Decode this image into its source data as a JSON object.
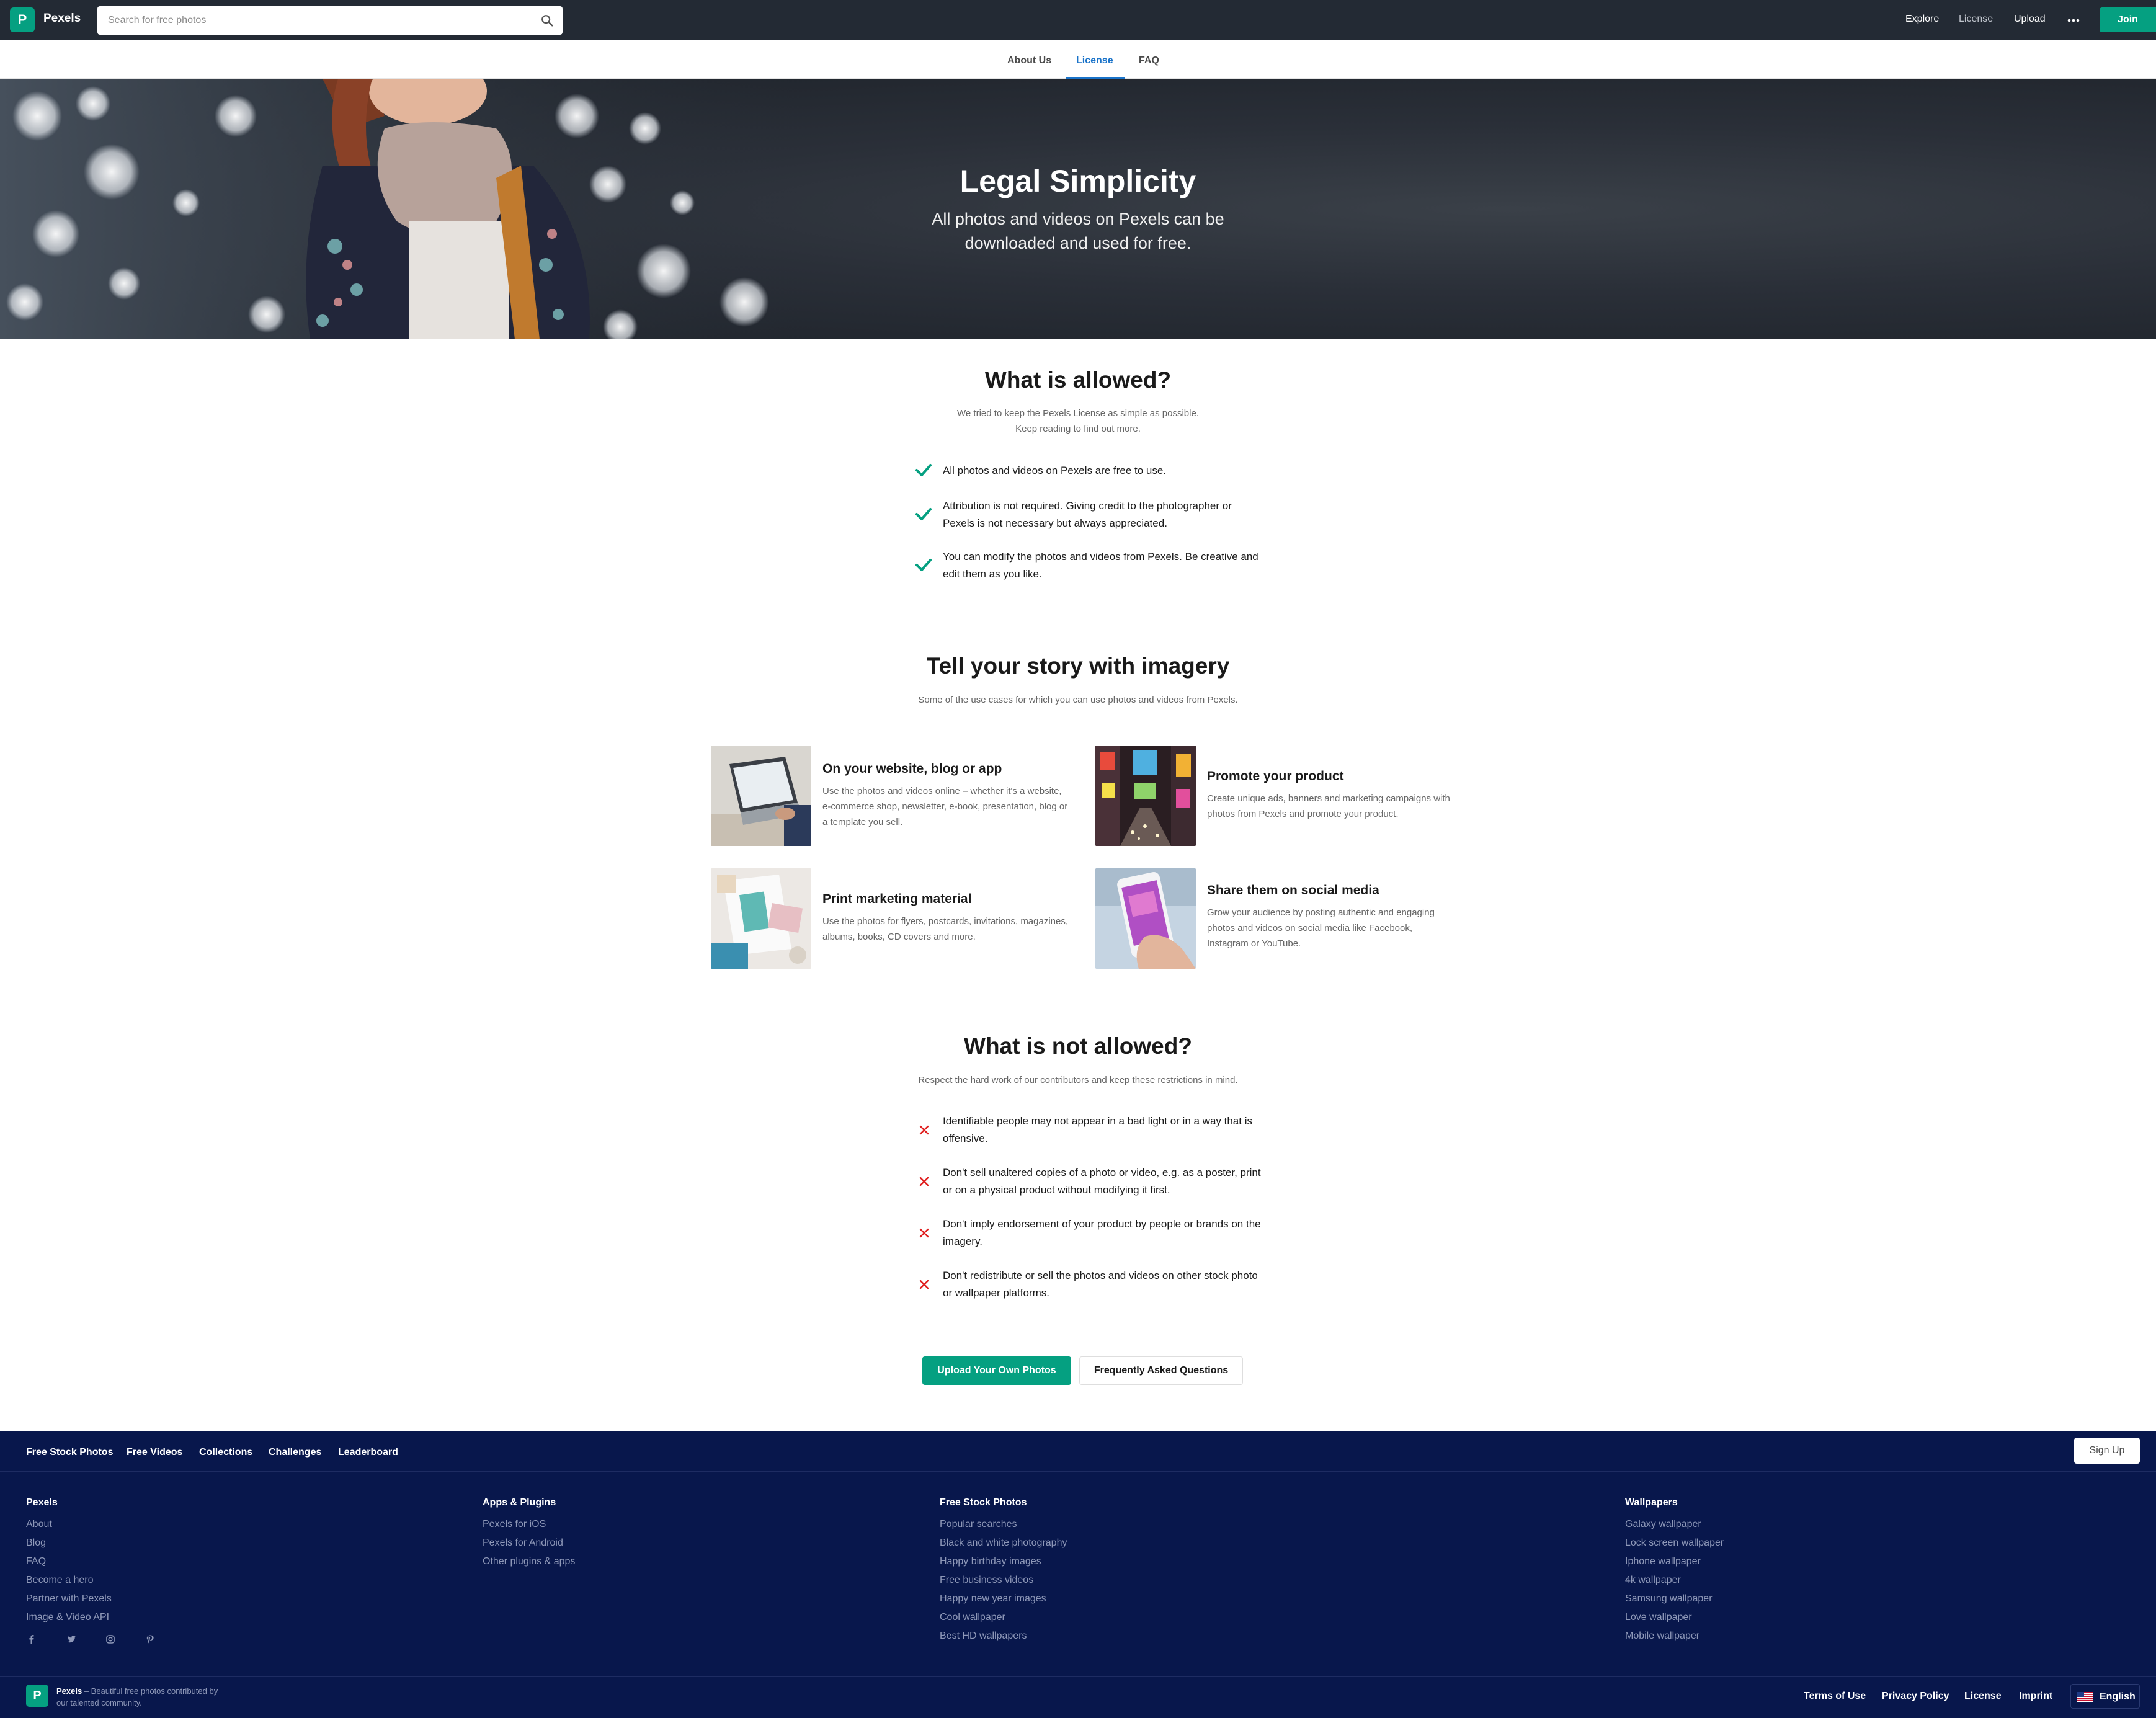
{
  "header": {
    "logo_letter": "P",
    "brand": "Pexels",
    "search_placeholder": "Search for free photos",
    "nav": [
      "Explore",
      "License",
      "Upload"
    ],
    "join_label": "Join"
  },
  "subnav": {
    "tabs": [
      "About Us",
      "License",
      "FAQ"
    ],
    "active": "License"
  },
  "hero": {
    "title": "Legal Simplicity",
    "subtitle": "All photos and videos on Pexels can be downloaded and used for free."
  },
  "allowed": {
    "title": "What is allowed?",
    "lead_line1": "We tried to keep the Pexels License as simple as possible.",
    "lead_line2": "Keep reading to find out more.",
    "items": [
      "All photos and videos on Pexels are free to use.",
      "Attribution is not required. Giving credit to the photographer or Pexels is not necessary but always appreciated.",
      "You can modify the photos and videos from Pexels. Be creative and edit them as you like."
    ]
  },
  "story": {
    "title": "Tell your story with imagery",
    "lead": "Some of the use cases for which you can use photos and videos from Pexels.",
    "cases": [
      {
        "title": "On your website, blog or app",
        "desc": "Use the photos and videos online – whether it's a website, e-commerce shop, newsletter, e-book, presentation, blog or a template you sell."
      },
      {
        "title": "Promote your product",
        "desc": "Create unique ads, banners and marketing campaigns with photos from Pexels and promote your product."
      },
      {
        "title": "Print marketing material",
        "desc": "Use the photos for flyers, postcards, invitations, magazines, albums, books, CD covers and more."
      },
      {
        "title": "Share them on social media",
        "desc": "Grow your audience by posting authentic and engaging photos and videos on social media like Facebook, Instagram or YouTube."
      }
    ]
  },
  "not_allowed": {
    "title": "What is not allowed?",
    "lead": "Respect the hard work of our contributors and keep these restrictions in mind.",
    "items": [
      "Identifiable people may not appear in a bad light or in a way that is offensive.",
      "Don't sell unaltered copies of a photo or video, e.g. as a poster, print or on a physical product without modifying it first.",
      "Don't imply endorsement of your product by people or brands on the imagery.",
      "Don't redistribute or sell the photos and videos on other stock photo or wallpaper platforms."
    ]
  },
  "buttons": {
    "upload": "Upload Your Own Photos",
    "faq": "Frequently Asked Questions"
  },
  "footer": {
    "nav": [
      "Free Stock Photos",
      "Free Videos",
      "Collections",
      "Challenges",
      "Leaderboard"
    ],
    "signup": "Sign Up",
    "columns": [
      {
        "title": "Pexels",
        "links": [
          "About",
          "Blog",
          "FAQ",
          "Become a hero",
          "Partner with Pexels",
          "Image & Video API"
        ]
      },
      {
        "title": "Apps & Plugins",
        "links": [
          "Pexels for iOS",
          "Pexels for Android",
          "Other plugins & apps"
        ]
      },
      {
        "title": "Free Stock Photos",
        "links": [
          "Popular searches",
          "Black and white photography",
          "Happy birthday images",
          "Free business videos",
          "Happy new year images",
          "Cool wallpaper",
          "Best HD wallpapers"
        ]
      },
      {
        "title": "Wallpapers",
        "links": [
          "Galaxy wallpaper",
          "Lock screen wallpaper",
          "Iphone wallpaper",
          "4k wallpaper",
          "Samsung wallpaper",
          "Love wallpaper",
          "Mobile wallpaper"
        ]
      }
    ],
    "social_icons": [
      "facebook-icon",
      "twitter-icon",
      "instagram-icon",
      "pinterest-icon"
    ],
    "brand_name": "Pexels",
    "tagline_1": "– Beautiful free photos contributed by",
    "tagline_2": "our talented community.",
    "bottom_links": [
      "Terms of Use",
      "Privacy Policy",
      "License",
      "Imprint"
    ],
    "language": "English"
  },
  "colors": {
    "brand_green": "#05a081",
    "active_blue": "#1a73c9",
    "header_bg": "#232a34",
    "footer_bg": "#08174c",
    "cross_red": "#e02020"
  }
}
